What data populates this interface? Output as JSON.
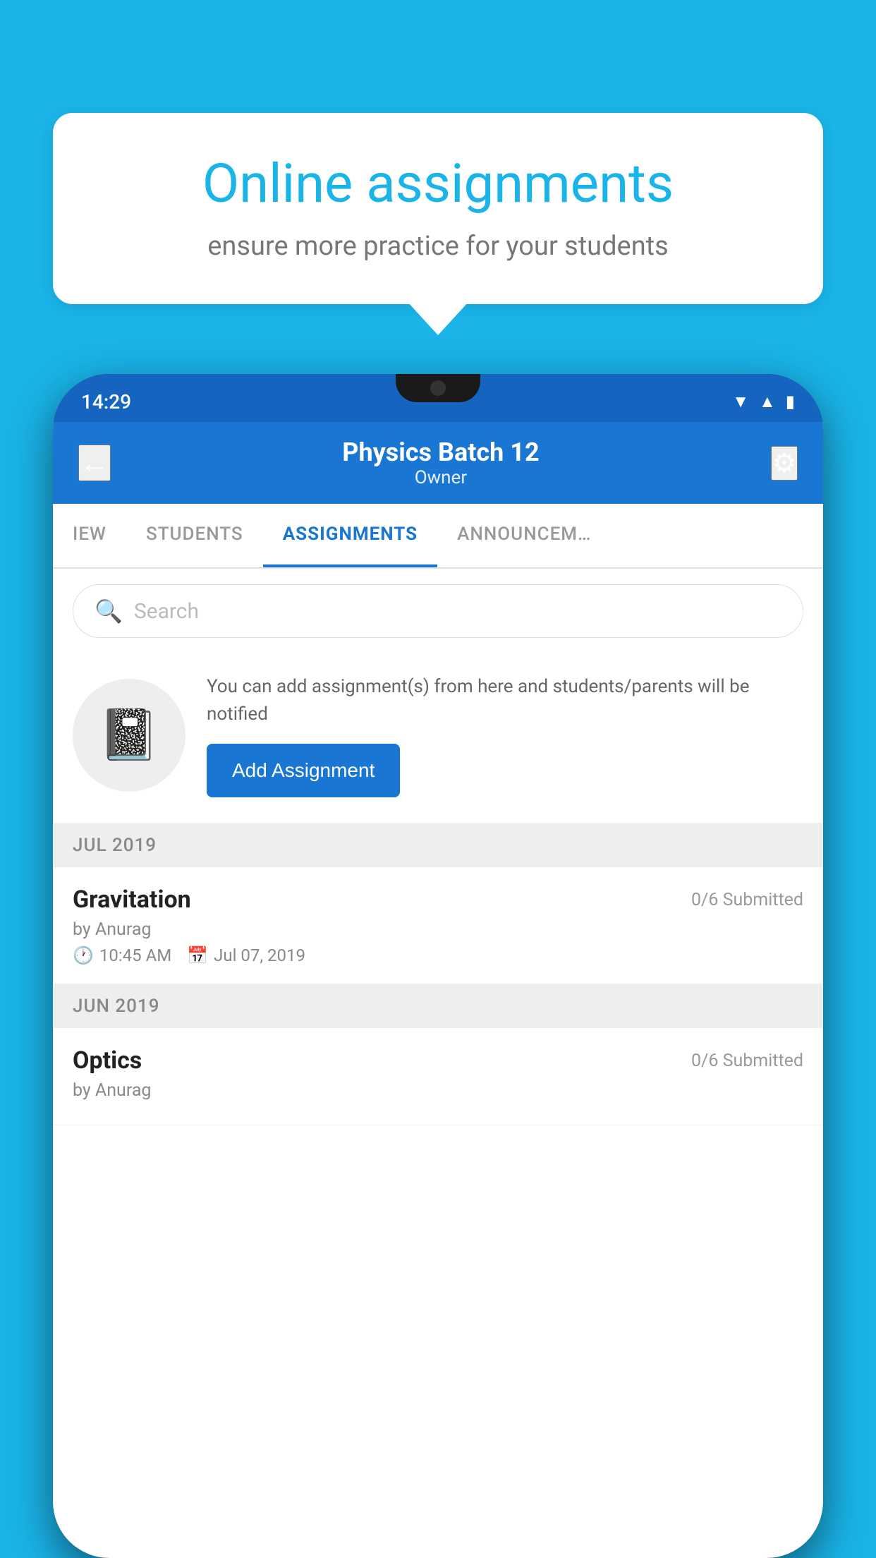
{
  "background_color": "#1ab4e8",
  "speech_bubble": {
    "title": "Online assignments",
    "subtitle": "ensure more practice for your students"
  },
  "phone": {
    "status_bar": {
      "time": "14:29",
      "icons": [
        "wifi",
        "signal",
        "battery"
      ]
    },
    "header": {
      "title": "Physics Batch 12",
      "subtitle": "Owner",
      "back_label": "←",
      "settings_label": "⚙"
    },
    "tabs": [
      {
        "label": "IEW",
        "active": false
      },
      {
        "label": "STUDENTS",
        "active": false
      },
      {
        "label": "ASSIGNMENTS",
        "active": true
      },
      {
        "label": "ANNOUNCEM…",
        "active": false
      }
    ],
    "search": {
      "placeholder": "Search"
    },
    "add_assignment_section": {
      "description": "You can add assignment(s) from here and students/parents will be notified",
      "button_label": "Add Assignment"
    },
    "sections": [
      {
        "month": "JUL 2019",
        "items": [
          {
            "title": "Gravitation",
            "submitted": "0/6 Submitted",
            "author": "by Anurag",
            "time": "10:45 AM",
            "date": "Jul 07, 2019"
          }
        ]
      },
      {
        "month": "JUN 2019",
        "items": [
          {
            "title": "Optics",
            "submitted": "0/6 Submitted",
            "author": "by Anurag",
            "time": "",
            "date": ""
          }
        ]
      }
    ]
  }
}
